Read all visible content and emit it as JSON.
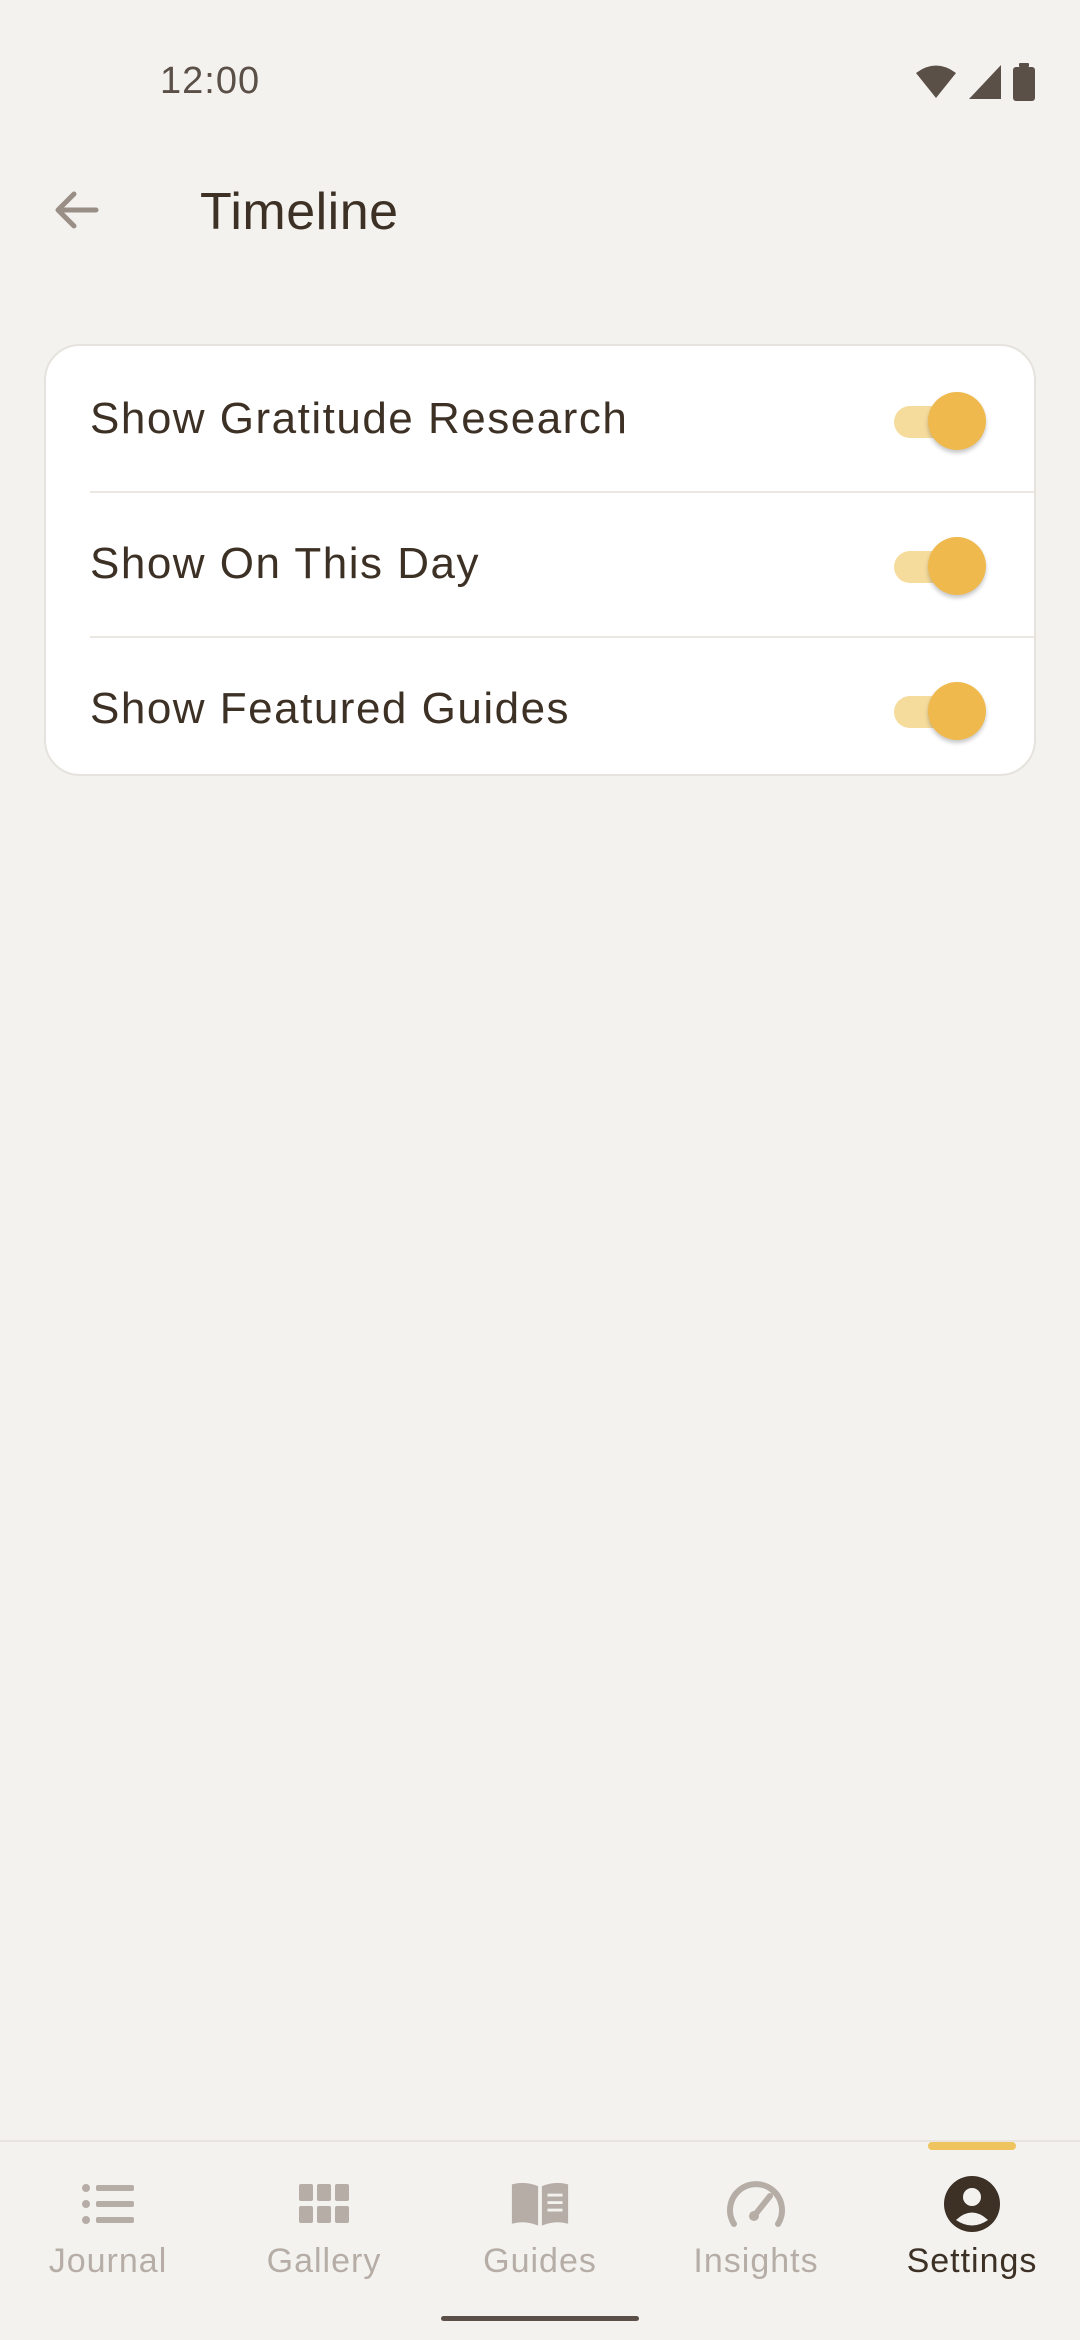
{
  "status_bar": {
    "time": "12:00",
    "icons": [
      "wifi-icon",
      "signal-icon",
      "battery-icon"
    ]
  },
  "app_bar": {
    "back_icon": "arrow-left-icon",
    "title": "Timeline"
  },
  "settings": {
    "rows": [
      {
        "label": "Show Gratitude Research",
        "enabled": true
      },
      {
        "label": "Show On This Day",
        "enabled": true
      },
      {
        "label": "Show Featured Guides",
        "enabled": true
      }
    ]
  },
  "bottom_nav": {
    "items": [
      {
        "label": "Journal",
        "icon": "list-icon",
        "active": false
      },
      {
        "label": "Gallery",
        "icon": "grid-icon",
        "active": false
      },
      {
        "label": "Guides",
        "icon": "book-icon",
        "active": false
      },
      {
        "label": "Insights",
        "icon": "gauge-icon",
        "active": false
      },
      {
        "label": "Settings",
        "icon": "account-circle-icon",
        "active": true
      }
    ]
  },
  "colors": {
    "background": "#f3f2ef",
    "card": "#ffffff",
    "accent": "#efb94d",
    "accent_track": "#f6dc9c",
    "text_primary": "#3d3126",
    "text_inactive": "#b6aea6"
  }
}
